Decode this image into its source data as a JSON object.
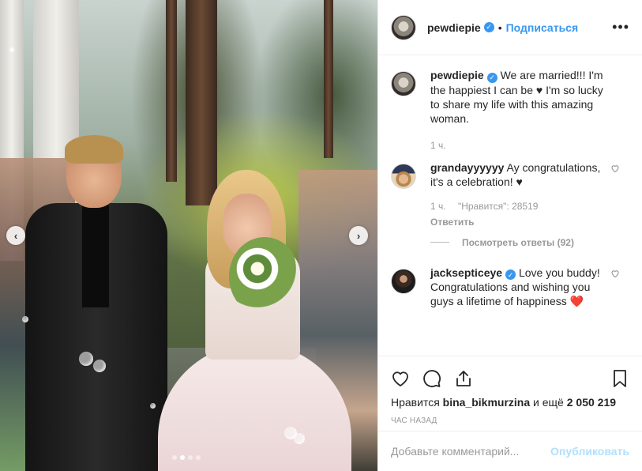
{
  "header": {
    "username": "pewdiepie",
    "separator": "•",
    "follow_label": "Подписаться",
    "more_label": "•••"
  },
  "caption": {
    "username": "pewdiepie",
    "text": "We are married!!! I'm the happiest I can be ♥ I'm so lucky to share my life with this amazing woman.",
    "time": "1 ч."
  },
  "comments": [
    {
      "username": "grandayyyyyy",
      "text": "Ay congratulations, it's a celebration! ♥",
      "time": "1 ч.",
      "likes": "\"Нравится\": 28519",
      "reply_label": "Ответить",
      "view_replies": "Посмотреть ответы (92)"
    },
    {
      "username": "jacksepticeye",
      "text": "Love you buddy! Congratulations and wishing you guys a lifetime of happiness ❤️"
    }
  ],
  "actions": {
    "likes_prefix": "Нравится",
    "likes_user": "bina_bikmurzina",
    "likes_suffix": "и ещё",
    "likes_count": "2 050 219",
    "time_ago": "ЧАС НАЗАД"
  },
  "add_comment": {
    "placeholder": "Добавьте комментарий...",
    "post_label": "Опубликовать"
  },
  "carousel": {
    "prev_label": "‹",
    "next_label": "›",
    "dot_count": 4,
    "active_dot": 1
  },
  "colors": {
    "accent": "#3897f0",
    "post_disabled": "#b2dffc",
    "meta_gray": "#999999",
    "text": "#262626"
  },
  "icons": {
    "like": "heart-icon",
    "comment": "comment-icon",
    "share": "share-icon",
    "save": "bookmark-icon",
    "verified": "verified-badge-icon"
  }
}
